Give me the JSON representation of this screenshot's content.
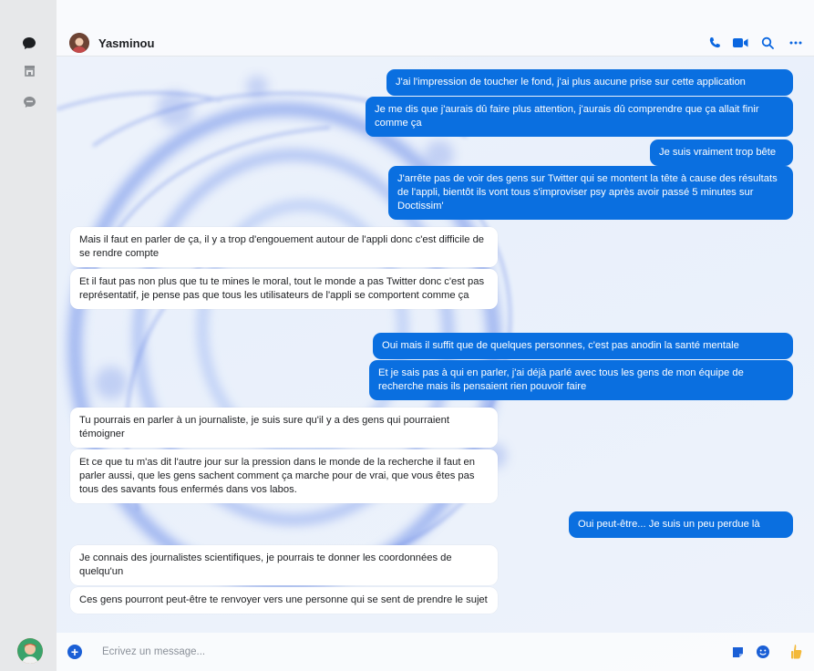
{
  "contact": {
    "name": "Yasminou"
  },
  "composer": {
    "placeholder": "Écrivez un message..."
  },
  "messages": [
    {
      "side": "out",
      "text": "J'ai l'impression de toucher le fond, j'ai plus aucune prise sur cette application"
    },
    {
      "side": "out",
      "text": "Je me dis que j'aurais dû faire plus attention, j'aurais dû comprendre que ça allait finir comme ça"
    },
    {
      "side": "out",
      "text": "Je suis vraiment trop bête"
    },
    {
      "side": "out",
      "text": "J'arrête pas de voir des gens sur Twitter qui se montent la tête à cause des résultats de l'appli, bientôt ils vont tous s'improviser psy après avoir passé 5 minutes sur Doctissim'"
    },
    {
      "side": "in",
      "text": "Mais il faut en parler de ça, il y a trop d'engouement autour de l'appli donc c'est difficile de se rendre compte"
    },
    {
      "side": "in",
      "text": "Et il faut pas non plus que tu te mines le moral, tout le monde a pas Twitter donc c'est pas représentatif, je pense pas que tous les utilisateurs de l'appli se comportent comme ça"
    },
    {
      "side": "out",
      "text": "Oui mais il suffit que de quelques personnes, c'est pas anodin la santé mentale"
    },
    {
      "side": "out",
      "text": "Et je sais pas à qui en parler, j'ai déjà parlé avec tous les gens de mon équipe de recherche mais ils pensaient rien pouvoir faire"
    },
    {
      "side": "in",
      "text": "Tu pourrais en parler à un journaliste, je suis sure qu'il y a des gens qui pourraient témoigner"
    },
    {
      "side": "in",
      "text": "Et ce que tu m'as dit l'autre jour sur la pression dans le monde de la recherche il faut en parler aussi, que les gens sachent comment ça marche pour de vrai, que vous êtes pas tous des savants fous enfermés dans vos labos."
    },
    {
      "side": "out",
      "text": "Oui peut-être... Je suis un peu perdue là"
    },
    {
      "side": "in",
      "text": "Je connais des journalistes scientifiques, je pourrais te donner les coordonnées de quelqu'un"
    },
    {
      "side": "in",
      "text": "Ces gens pourront peut-être te renvoyer vers une personne qui se sent de prendre le sujet"
    }
  ],
  "icons": {
    "rail": [
      "chat-icon",
      "marketplace-icon",
      "archive-icon"
    ],
    "header": [
      "phone-icon",
      "video-icon",
      "search-icon",
      "more-icon"
    ],
    "composer": [
      "add-icon",
      "sticker-icon",
      "emoji-icon",
      "thumbs-up-icon"
    ]
  },
  "colors": {
    "outgoing": "#0a6fe0",
    "incoming": "#ffffff",
    "accent": "#1a5fd6"
  }
}
